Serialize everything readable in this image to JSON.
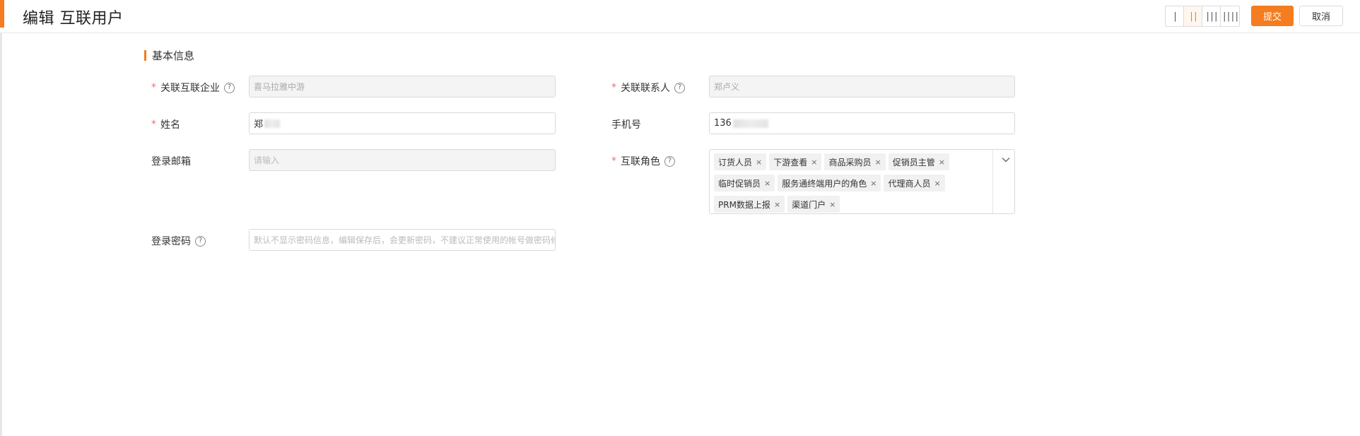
{
  "header": {
    "title": "编辑 互联用户",
    "column_switch": [
      {
        "label": "|",
        "active": false
      },
      {
        "label": "||",
        "active": true
      },
      {
        "label": "|||",
        "active": false
      },
      {
        "label": "||||",
        "active": false
      }
    ],
    "submit_label": "提交",
    "cancel_label": "取消"
  },
  "section": {
    "title": "基本信息"
  },
  "form": {
    "linked_company": {
      "label": "关联互联企业",
      "value": "喜马拉雅中游",
      "required": true
    },
    "linked_contact": {
      "label": "关联联系人",
      "value": "郑卢义",
      "required": true
    },
    "name": {
      "label": "姓名",
      "value": "郑",
      "required": true
    },
    "phone": {
      "label": "手机号",
      "value": "136",
      "required": false
    },
    "email": {
      "label": "登录邮箱",
      "placeholder": "请输入",
      "required": false
    },
    "roles": {
      "label": "互联角色",
      "required": true,
      "tags": [
        "订货人员",
        "下游查看",
        "商品采购员",
        "促销员主管",
        "临时促销员",
        "服务通终端用户的角色",
        "代理商人员",
        "PRM数据上报",
        "渠道门户"
      ]
    },
    "password": {
      "label": "登录密码",
      "placeholder": "默认不显示密码信息，编辑保存后，会更新密码，不建议正常使用的帐号做密码修改"
    }
  },
  "icons": {
    "help": "question-circle-icon",
    "tag_remove": "close-icon",
    "dropdown": "chevron-down-icon"
  },
  "colors": {
    "accent": "#f57c1f",
    "required": "#f56c6c"
  }
}
